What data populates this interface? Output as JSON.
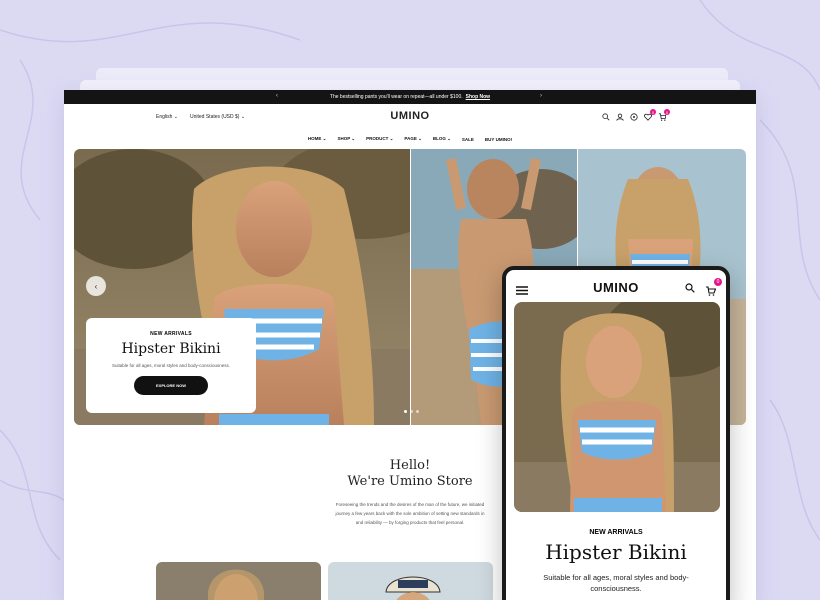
{
  "announcement": {
    "text": "The bestselling pants you'll wear on repeat—all under $100.",
    "link": "Shop Now"
  },
  "topbar": {
    "language": "English",
    "currency": "United States (USD $)",
    "logo": "UMINO",
    "wishlist_count": "0",
    "cart_count": "0"
  },
  "nav": [
    "HOME",
    "SHOP",
    "PRODUCT",
    "PAGE",
    "BLOG",
    "SALE",
    "BUY UMINO!"
  ],
  "hero": {
    "kicker": "NEW ARRIVALS",
    "title": "Hipster Bikini",
    "subtitle": "Suitable for all ages, moral styles and body-consciousness.",
    "button": "EXPLORE NOW"
  },
  "welcome": {
    "line1": "Hello!",
    "line2": "We're Umino Store",
    "para1": "Foreseeing the trends and the desires of the man of the future, we initiated",
    "para2": "journey a few years back with the sole ambition of setting new standards in",
    "para3": "and reliability — by forging products that feel personal."
  },
  "mobile": {
    "logo": "UMINO",
    "cart_count": "0",
    "kicker": "NEW ARRIVALS",
    "title": "Hipster Bikini",
    "subtitle": "Suitable for all ages, moral styles and body-consciousness."
  },
  "colors": {
    "accent": "#e5168a",
    "dark": "#141414",
    "background": "#dcdaf3"
  }
}
